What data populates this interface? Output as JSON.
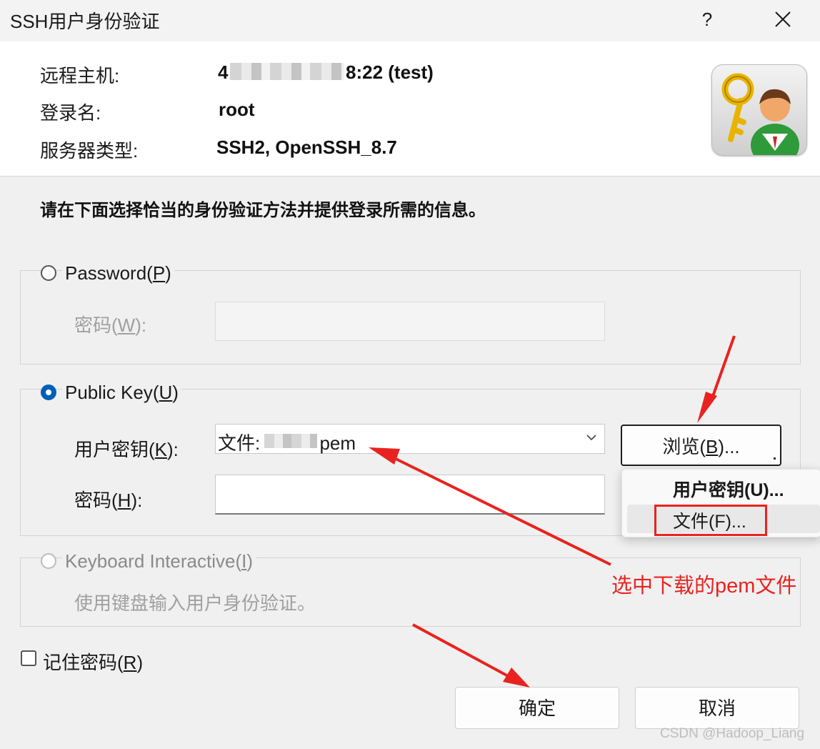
{
  "window": {
    "title": "SSH用户身份验证",
    "help_label": "?"
  },
  "header": {
    "remote_host_label": "远程主机:",
    "remote_host_prefix": "4",
    "remote_host_suffix": "8:22 (test)",
    "login_label": "登录名:",
    "login_value": "root",
    "server_type_label": "服务器类型:",
    "server_type_value": "SSH2, OpenSSH_8.7"
  },
  "instruction": "请在下面选择恰当的身份验证方法并提供登录所需的信息。",
  "password_group": {
    "option_label": "Password(",
    "option_accel": "P",
    "option_suffix": ")",
    "field_label": "密码(",
    "field_accel": "W",
    "field_suffix": "):",
    "selected": false
  },
  "publickey_group": {
    "option_label": "Public Key(",
    "option_accel": "U",
    "option_suffix": ")",
    "selected": true,
    "user_key_label": "用户密钥(",
    "user_key_accel": "K",
    "user_key_suffix": "):",
    "user_key_value_prefix": "文件: ",
    "user_key_value_suffix": "pem",
    "passphrase_label": "密码(",
    "passphrase_accel": "H",
    "passphrase_suffix": "):",
    "browse_label": "浏览(",
    "browse_accel": "B",
    "browse_suffix": ")..."
  },
  "browse_menu": {
    "items": [
      {
        "label": "用户密钥(U)...",
        "bold": true
      },
      {
        "label": "文件(F)...",
        "bold": false,
        "highlighted": true
      }
    ]
  },
  "keyboard_group": {
    "option_label": "Keyboard Interactive(",
    "option_accel": "I",
    "option_suffix": ")",
    "description": "使用键盘输入用户身份验证。",
    "selected": false
  },
  "remember": {
    "label": "记住密码(",
    "accel": "R",
    "suffix": ")",
    "checked": false
  },
  "buttons": {
    "ok": "确定",
    "cancel": "取消"
  },
  "annotation": {
    "text": "选中下载的pem文件",
    "color": "#e8231f"
  },
  "watermark": "CSDN @Hadoop_Liang"
}
